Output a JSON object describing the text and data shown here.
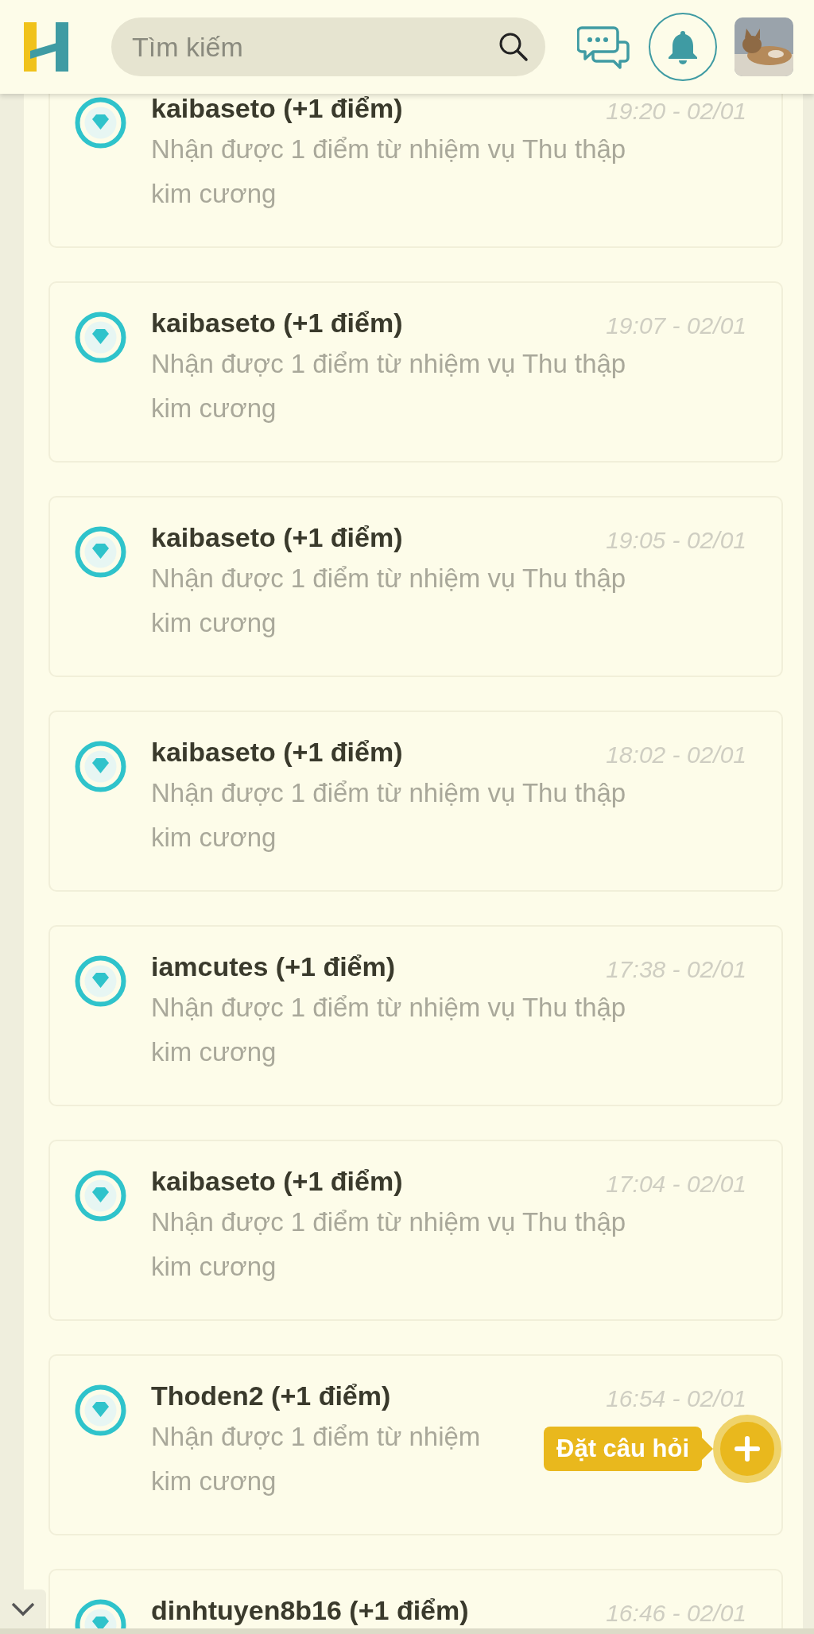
{
  "header": {
    "search": {
      "placeholder": "Tìm kiếm"
    }
  },
  "notifications": [
    {
      "title": "kaibaseto (+1 điểm)",
      "time": "19:20 - 02/01",
      "message": "Nhận được 1 điểm từ nhiệm vụ Thu thập kim cương"
    },
    {
      "title": "kaibaseto (+1 điểm)",
      "time": "19:07 - 02/01",
      "message": "Nhận được 1 điểm từ nhiệm vụ Thu thập kim cương"
    },
    {
      "title": "kaibaseto (+1 điểm)",
      "time": "19:05 - 02/01",
      "message": "Nhận được 1 điểm từ nhiệm vụ Thu thập kim cương"
    },
    {
      "title": "kaibaseto (+1 điểm)",
      "time": "18:02 - 02/01",
      "message": "Nhận được 1 điểm từ nhiệm vụ Thu thập kim cương"
    },
    {
      "title": "iamcutes (+1 điểm)",
      "time": "17:38 - 02/01",
      "message": "Nhận được 1 điểm từ nhiệm vụ Thu thập kim cương"
    },
    {
      "title": "kaibaseto (+1 điểm)",
      "time": "17:04 - 02/01",
      "message": "Nhận được 1 điểm từ nhiệm vụ Thu thập kim cương"
    },
    {
      "title": "Thoden2 (+1 điểm)",
      "time": "16:54 - 02/01",
      "message_lines": [
        "Nhận được 1 điểm từ nhiệm",
        "kim cương"
      ]
    },
    {
      "title": "dinhtuyen8b16 (+1 điểm)",
      "time": "16:46 - 02/01"
    }
  ],
  "ask_button": {
    "label": "Đặt câu hỏi"
  }
}
